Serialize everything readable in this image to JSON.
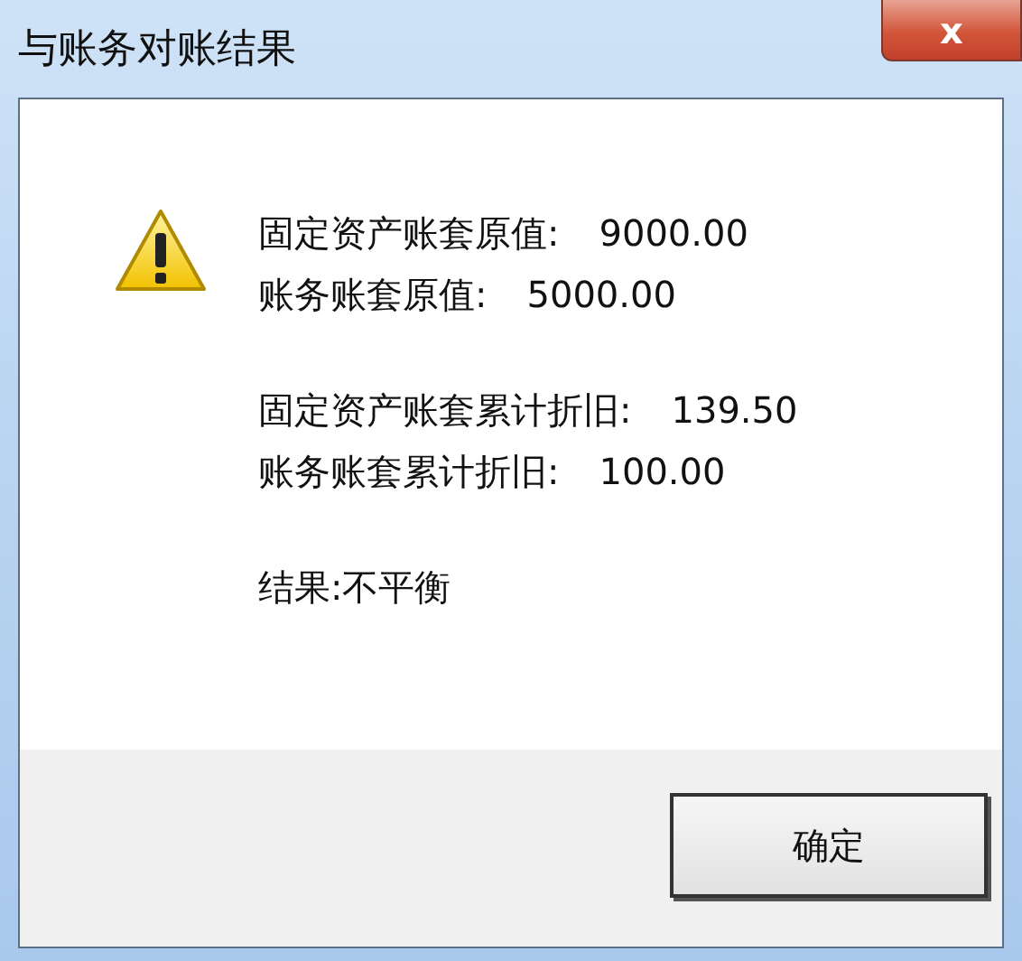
{
  "window": {
    "title": "与账务对账结果",
    "close": "x"
  },
  "message": {
    "groups": [
      {
        "lines": [
          {
            "label": "固定资产账套原值:",
            "value": "9000.00"
          },
          {
            "label": "账务账套原值:",
            "value": "5000.00"
          }
        ]
      },
      {
        "lines": [
          {
            "label": "固定资产账套累计折旧:",
            "value": "139.50"
          },
          {
            "label": "账务账套累计折旧:",
            "value": "100.00"
          }
        ]
      }
    ],
    "result": "结果:不平衡"
  },
  "buttons": [
    {
      "label": "确定",
      "focused": true
    }
  ]
}
